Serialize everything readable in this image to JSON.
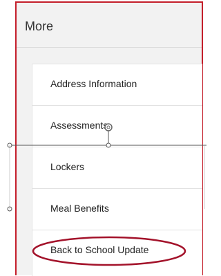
{
  "panel": {
    "title": "More"
  },
  "menu": {
    "items": [
      {
        "label": "Address Information"
      },
      {
        "label": "Assessments"
      },
      {
        "label": "Lockers"
      },
      {
        "label": "Meal Benefits"
      },
      {
        "label": "Back to School Update",
        "highlighted": true
      }
    ]
  },
  "colors": {
    "frame_border": "#c41e2a",
    "highlight_ellipse": "#a3122a",
    "header_bg": "#f2f2f2",
    "card_bg": "#ffffff",
    "text": "#222222"
  }
}
